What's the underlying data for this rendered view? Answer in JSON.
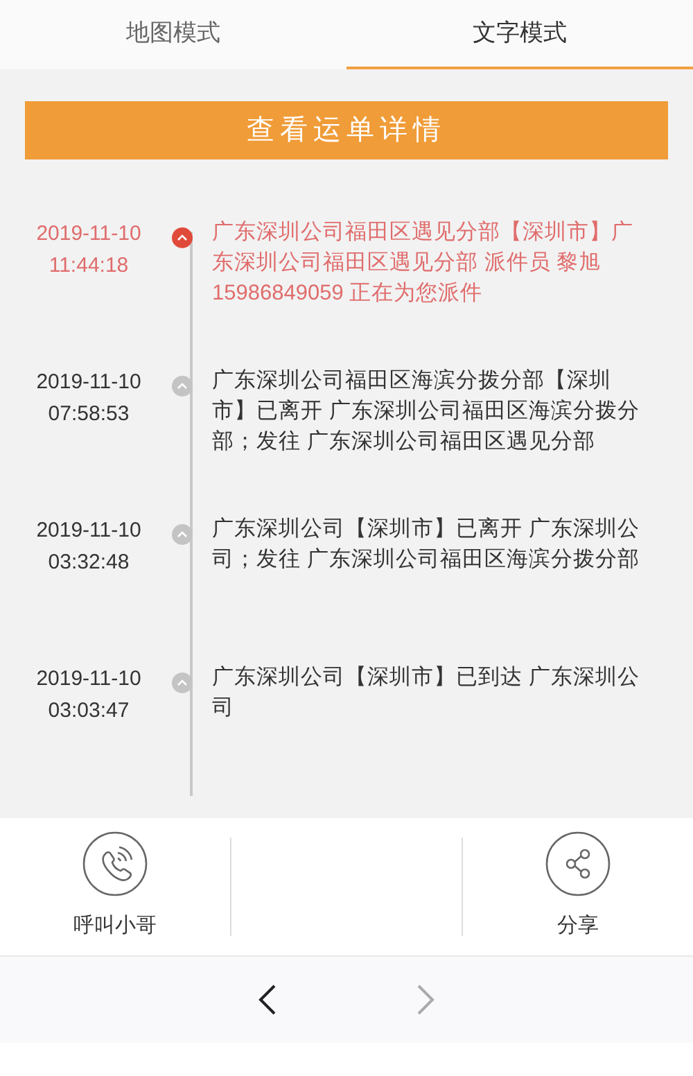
{
  "tabs": [
    {
      "label": "地图模式",
      "selected": false
    },
    {
      "label": "文字模式",
      "selected": true
    }
  ],
  "detail_button": "查看运单详情",
  "events": [
    {
      "date": "2019-11-10",
      "time": "11:44:18",
      "text": "广东深圳公司福田区遇见分部【深圳市】广东深圳公司福田区遇见分部 派件员 黎旭 15986849059 正在为您派件",
      "latest": true
    },
    {
      "date": "2019-11-10",
      "time": "07:58:53",
      "text": "广东深圳公司福田区海滨分拨分部【深圳市】已离开 广东深圳公司福田区海滨分拨分部；发往 广东深圳公司福田区遇见分部",
      "latest": false
    },
    {
      "date": "2019-11-10",
      "time": "03:32:48",
      "text": "广东深圳公司【深圳市】已离开 广东深圳公司；发往 广东深圳公司福田区海滨分拨分部",
      "latest": false
    },
    {
      "date": "2019-11-10",
      "time": "03:03:47",
      "text": "广东深圳公司【深圳市】已到达 广东深圳公司",
      "latest": false
    }
  ],
  "actions": [
    {
      "kind": "call",
      "label": "呼叫小哥"
    },
    {
      "kind": "empty"
    },
    {
      "kind": "share",
      "label": "分享"
    }
  ],
  "nav": {
    "back_disabled": false,
    "forward_disabled": true
  }
}
